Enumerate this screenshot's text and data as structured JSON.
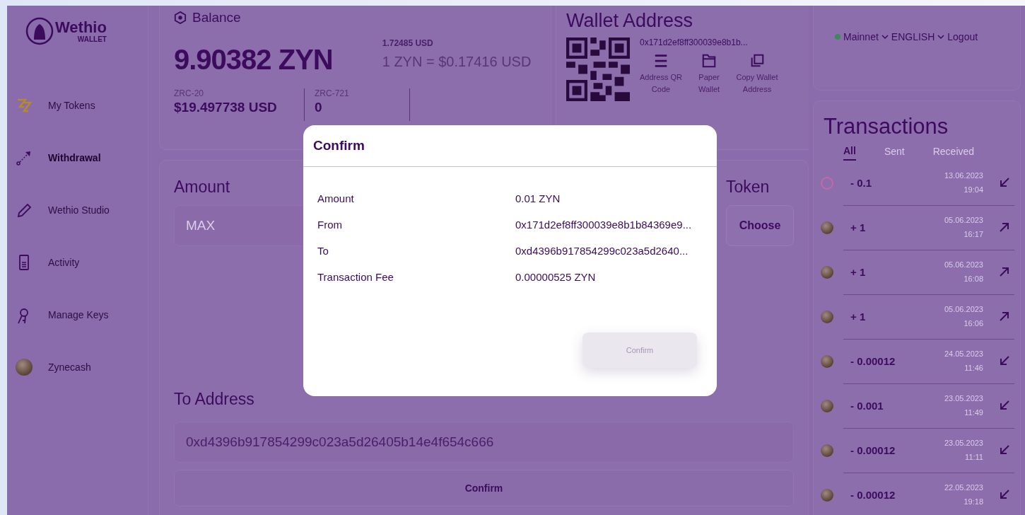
{
  "sidebar": {
    "logo": {
      "name": "Wethio",
      "sub": "WALLET"
    },
    "items": [
      {
        "label": "My Tokens",
        "selected": false
      },
      {
        "label": "Withdrawal",
        "selected": true
      },
      {
        "label": "Wethio Studio",
        "selected": false
      },
      {
        "label": "Activity",
        "selected": false
      },
      {
        "label": "Manage Keys",
        "selected": false
      },
      {
        "label": "Zynecash",
        "selected": false
      }
    ]
  },
  "balance": {
    "title": "Balance",
    "amount": "9.90382 ZYN",
    "usd": "1.72485 USD",
    "rate": "1 ZYN = $0.17416 USD",
    "tokens": [
      {
        "label": "ZRC-20",
        "value": "$19.497738 USD"
      },
      {
        "label": "ZRC-721",
        "value": "0"
      }
    ]
  },
  "wallet": {
    "title": "Wallet Address",
    "address": "0x171d2ef8ff300039e8b1b...",
    "actions": [
      {
        "label": "Address QR Code"
      },
      {
        "label": "Paper Wallet"
      },
      {
        "label": "Copy Wallet Address"
      }
    ]
  },
  "top_bar": {
    "network": "Mainnet",
    "language": "ENGLISH",
    "logout": "Logout"
  },
  "form": {
    "amount_label": "Amount",
    "amount_placeholder": "MAX",
    "token_label": "Token",
    "choose": "Choose",
    "to_label": "To Address",
    "to_value": "0xd4396b917854299c023a5d26405b14e4f654c666",
    "confirm": "Confirm"
  },
  "transactions": {
    "title": "Transactions",
    "tabs": [
      {
        "label": "All",
        "selected": true
      },
      {
        "label": "Sent",
        "selected": false
      },
      {
        "label": "Received",
        "selected": false
      }
    ],
    "rows": [
      {
        "kind": "outline",
        "amount": "- 0.1",
        "date": "13.06.2023",
        "time": "19:04",
        "incoming": false
      },
      {
        "kind": "coin",
        "amount": "+ 1",
        "date": "05.06.2023",
        "time": "16:17",
        "incoming": true
      },
      {
        "kind": "coin",
        "amount": "+ 1",
        "date": "05.06.2023",
        "time": "16:08",
        "incoming": true
      },
      {
        "kind": "coin",
        "amount": "+ 1",
        "date": "05.06.2023",
        "time": "16:06",
        "incoming": true
      },
      {
        "kind": "coin",
        "amount": "- 0.00012",
        "date": "24.05.2023",
        "time": "11:46",
        "incoming": false
      },
      {
        "kind": "coin",
        "amount": "- 0.001",
        "date": "23.05.2023",
        "time": "11:49",
        "incoming": false
      },
      {
        "kind": "coin",
        "amount": "- 0.00012",
        "date": "23.05.2023",
        "time": "11:11",
        "incoming": false
      },
      {
        "kind": "coin",
        "amount": "- 0.00012",
        "date": "22.05.2023",
        "time": "19:18",
        "incoming": false
      }
    ]
  },
  "modal": {
    "title": "Confirm",
    "rows": [
      {
        "label": "Amount",
        "value": "0.01 ZYN"
      },
      {
        "label": "From",
        "value": "0x171d2ef8ff300039e8b1b84369e9..."
      },
      {
        "label": "To",
        "value": "0xd4396b917854299c023a5d2640..."
      },
      {
        "label": "Transaction Fee",
        "value": "0.00000525 ZYN"
      }
    ],
    "button": "Confirm",
    "button_disabled": true
  }
}
